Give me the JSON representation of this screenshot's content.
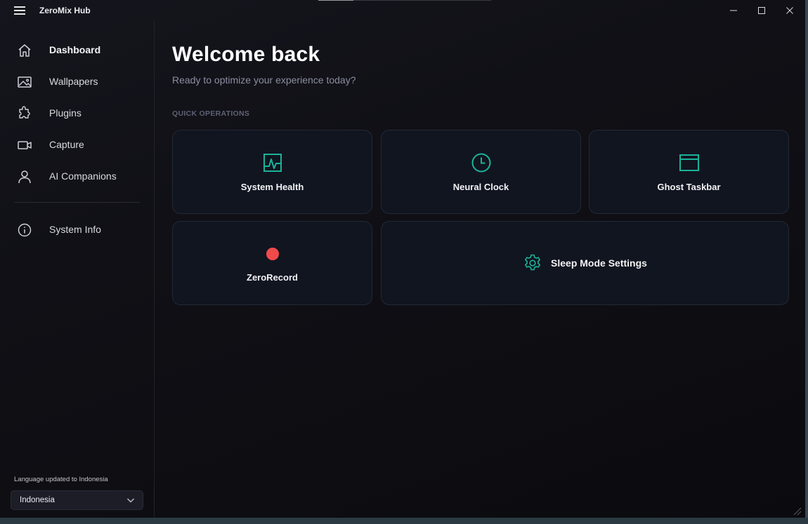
{
  "app": {
    "title": "ZeroMix Hub"
  },
  "sidebar": {
    "items": [
      {
        "label": "Dashboard",
        "icon": "home-icon",
        "active": true
      },
      {
        "label": "Wallpapers",
        "icon": "image-icon"
      },
      {
        "label": "Plugins",
        "icon": "puzzle-icon"
      },
      {
        "label": "Capture",
        "icon": "video-camera-icon"
      },
      {
        "label": "AI Companions",
        "icon": "person-icon"
      }
    ],
    "info": {
      "label": "System Info",
      "icon": "info-icon"
    },
    "language_status": "Language updated to Indonesia",
    "language_select": {
      "value": "Indonesia"
    }
  },
  "main": {
    "title": "Welcome back",
    "subtitle": "Ready to optimize your experience today?",
    "section_label": "QUICK OPERATIONS",
    "cards": [
      {
        "label": "System Health",
        "icon": "health-monitor-icon"
      },
      {
        "label": "Neural Clock",
        "icon": "clock-icon"
      },
      {
        "label": "Ghost Taskbar",
        "icon": "window-icon"
      },
      {
        "label": "ZeroRecord",
        "icon": "record-dot-icon"
      },
      {
        "label": "Sleep Mode Settings",
        "icon": "gear-icon"
      }
    ]
  },
  "colors": {
    "accent": "#1bb39a",
    "record": "#f04a4a",
    "card_bg": "#111520",
    "card_border": "#232836",
    "muted_text": "#8c8ea0"
  }
}
